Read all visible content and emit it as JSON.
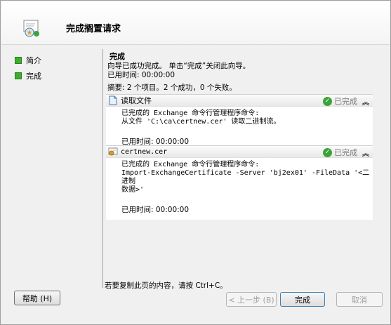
{
  "header": {
    "title": "完成搁置请求",
    "icon": "certificate-wizard-icon"
  },
  "nav": {
    "items": [
      {
        "label": "简介",
        "active": false
      },
      {
        "label": "完成",
        "active": true
      }
    ]
  },
  "content": {
    "step_title": "完成",
    "intro": "向导已成功完成。 单击“完成”关闭此向导。",
    "elapsed": "已用时间: 00:00:00",
    "summary": "摘要: 2 个项目。2 个成功，0 个失败。",
    "sections": [
      {
        "title": "读取文件",
        "status": "已完成",
        "line1": "已完成的 Exchange 命令行管理程序命令:",
        "line2": "从文件 'C:\\ca\\certnew.cer' 读取二进制流。",
        "elapsed": "已用时间: 00:00:00"
      },
      {
        "title": "certnew.cer",
        "status": "已完成",
        "line1": "已完成的 Exchange 命令行管理程序命令:",
        "line2": "Import-ExchangeCertificate -Server 'bj​​​2ex01' -FileData '<二进制",
        "line3": "数据>'",
        "elapsed": "已用时间: 00:00:00"
      }
    ],
    "copy_hint": "若要复制此页的内容，请按 Ctrl+C。"
  },
  "buttons": {
    "help": "帮助 (H)",
    "back": "< 上一步 (B)",
    "finish": "完成",
    "cancel": "取消"
  }
}
